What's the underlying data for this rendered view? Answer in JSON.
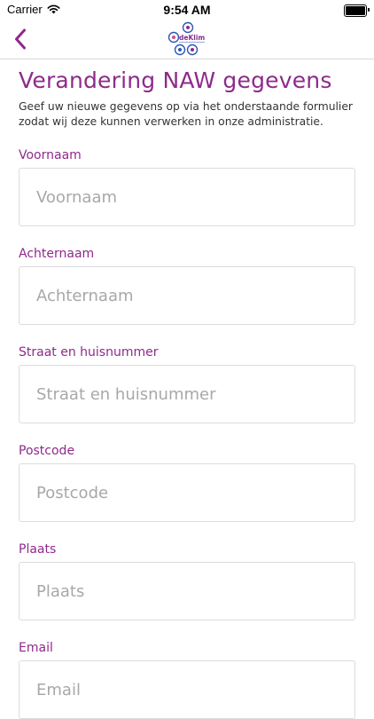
{
  "status_bar": {
    "carrier": "Carrier",
    "time": "9:54 AM",
    "battery_level": 1.0
  },
  "nav": {
    "back_icon": "chevron-left-icon",
    "logo_text": "deKlim",
    "accent_color": "#8e2a8b"
  },
  "page": {
    "title": "Verandering NAW gegevens",
    "intro": "Geef uw nieuwe gegevens op via het onderstaande formulier zodat wij deze kunnen verwerken in onze administratie."
  },
  "form": {
    "fields": [
      {
        "label": "Voornaam",
        "placeholder": "Voornaam",
        "value": ""
      },
      {
        "label": "Achternaam",
        "placeholder": "Achternaam",
        "value": ""
      },
      {
        "label": "Straat en huisnummer",
        "placeholder": "Straat en huisnummer",
        "value": ""
      },
      {
        "label": "Postcode",
        "placeholder": "Postcode",
        "value": ""
      },
      {
        "label": "Plaats",
        "placeholder": "Plaats",
        "value": ""
      },
      {
        "label": "Email",
        "placeholder": "Email",
        "value": ""
      }
    ]
  }
}
